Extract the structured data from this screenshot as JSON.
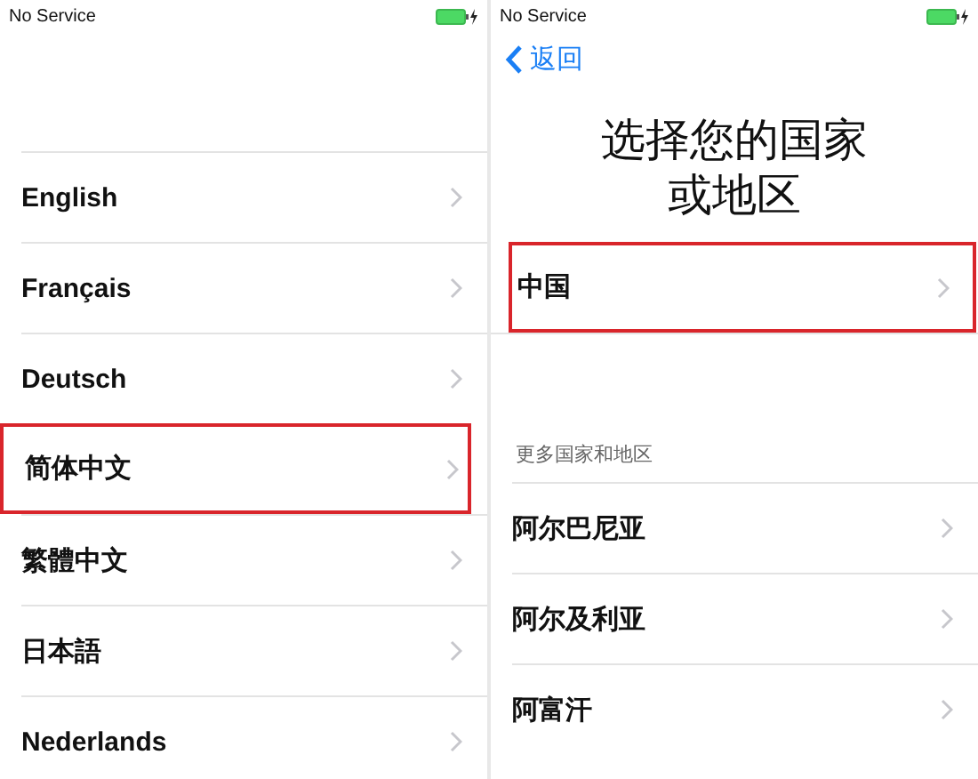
{
  "language_screen": {
    "status_bar": {
      "carrier": "No Service"
    },
    "languages": [
      {
        "label": "English",
        "highlighted": false
      },
      {
        "label": "Français",
        "highlighted": false
      },
      {
        "label": "Deutsch",
        "highlighted": false
      },
      {
        "label": "简体中文",
        "highlighted": true
      },
      {
        "label": "繁體中文",
        "highlighted": false
      },
      {
        "label": "日本語",
        "highlighted": false
      },
      {
        "label": "Nederlands",
        "highlighted": false
      }
    ]
  },
  "region_screen": {
    "status_bar": {
      "carrier": "No Service"
    },
    "back_button": "返回",
    "title_lines": [
      "选择您的国家",
      "或地区"
    ],
    "suggested": [
      {
        "label": "中国",
        "highlighted": true
      }
    ],
    "section_header": "更多国家和地区",
    "regions": [
      {
        "label": "阿尔巴尼亚",
        "highlighted": false
      },
      {
        "label": "阿尔及利亚",
        "highlighted": false
      },
      {
        "label": "阿富汗",
        "highlighted": false
      }
    ]
  }
}
